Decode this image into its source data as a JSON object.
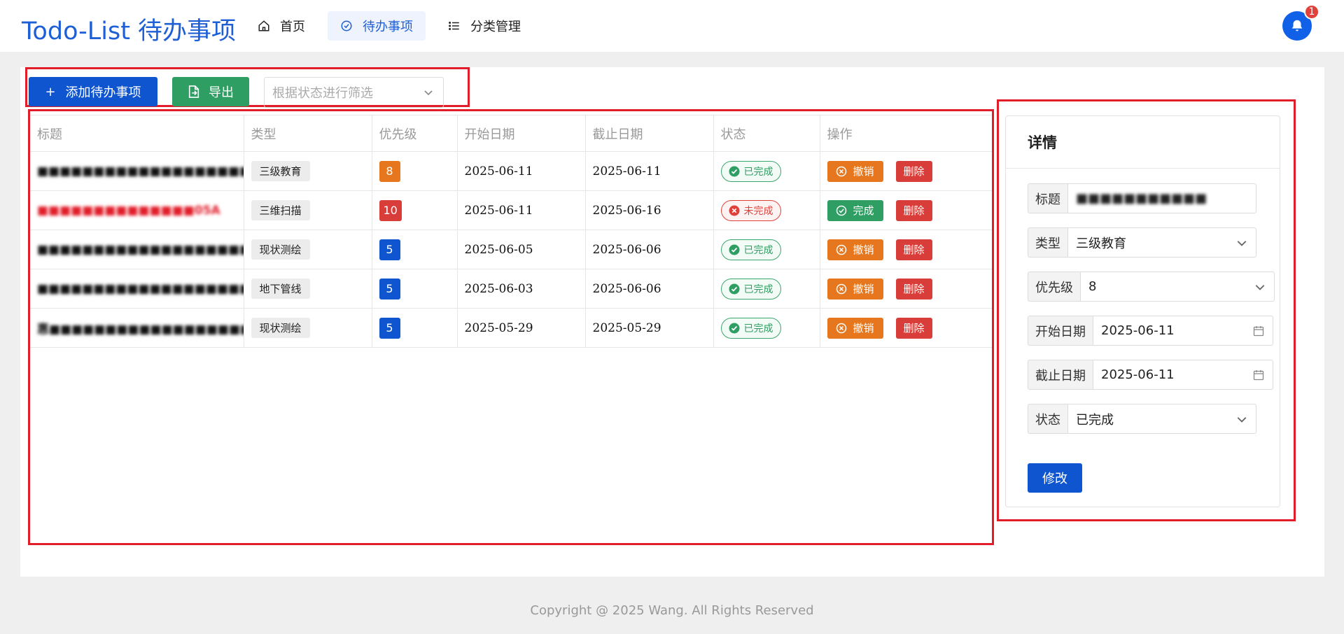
{
  "header": {
    "brand": "Todo-List 待办事项",
    "nav": [
      {
        "label": "首页",
        "icon": "home-icon"
      },
      {
        "label": "待办事项",
        "icon": "check-circle-icon"
      },
      {
        "label": "分类管理",
        "icon": "list-icon"
      }
    ],
    "notification_count": "1"
  },
  "toolbar": {
    "add_label": "添加待办事项",
    "export_label": "导出",
    "filter_placeholder": "根据状态进行筛选"
  },
  "table": {
    "columns": [
      "标题",
      "类型",
      "优先级",
      "开始日期",
      "截止日期",
      "状态",
      "操作"
    ],
    "rows": [
      {
        "title": "■■■■■■■■■■■■■■■■■■■■■■■■■■■■■■■■■",
        "type": "三级教育",
        "priority": "8",
        "start": "2025-06-11",
        "end": "2025-06-11",
        "status": "已完成",
        "action": "撤销",
        "delete": "删除"
      },
      {
        "title": "■■■■■■■■■■■■■■05A",
        "type": "三维扫描",
        "priority": "10",
        "start": "2025-06-11",
        "end": "2025-06-16",
        "status": "未完成",
        "action": "完成",
        "delete": "删除"
      },
      {
        "title": "■■■■■■■■■■■■■■■■■■■■■■■■■■■■■■■■■.",
        "type": "现状测绘",
        "priority": "5",
        "start": "2025-06-05",
        "end": "2025-06-06",
        "status": "已完成",
        "action": "撤销",
        "delete": "删除"
      },
      {
        "title": "■■■■■■■■■■■■■■■■■■■■■■■■■■■■■■...",
        "type": "地下管线",
        "priority": "5",
        "start": "2025-06-03",
        "end": "2025-06-06",
        "status": "已完成",
        "action": "撤销",
        "delete": "删除"
      },
      {
        "title": "惠■■■■■■■■■■■■■■■■■■■■■■■■■■■■■...",
        "type": "现状测绘",
        "priority": "5",
        "start": "2025-05-29",
        "end": "2025-05-29",
        "status": "已完成",
        "action": "撤销",
        "delete": "删除"
      }
    ]
  },
  "detail": {
    "title": "详情",
    "fields": {
      "title_label": "标题",
      "title_value": "■■■■■■■■■■■",
      "type_label": "类型",
      "type_value": "三级教育",
      "priority_label": "优先级",
      "priority_value": "8",
      "start_label": "开始日期",
      "start_value": "2025-06-11",
      "end_label": "截止日期",
      "end_value": "2025-06-11",
      "status_label": "状态",
      "status_value": "已完成"
    },
    "submit_label": "修改"
  },
  "footer": {
    "copyright": "Copyright @ 2025 Wang. All Rights Reserved"
  },
  "colors": {
    "primary": "#0f55cf",
    "success": "#2f9e62",
    "warning": "#e6771e",
    "danger": "#d83d39",
    "priority_8": "#e6771e",
    "priority_10": "#d83d39",
    "priority_5": "#0f55cf",
    "annotation_box": "#e11d2a"
  }
}
